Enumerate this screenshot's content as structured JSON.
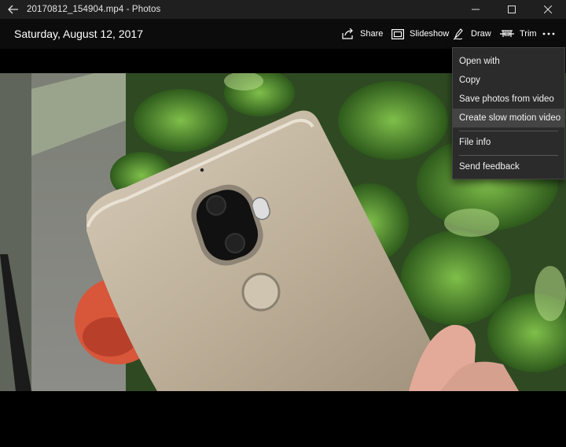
{
  "window": {
    "title": "20170812_154904.mp4 - Photos",
    "back_icon": "back-arrow-icon",
    "controls": [
      "minimize-icon",
      "maximize-icon",
      "close-icon"
    ]
  },
  "commandbar": {
    "date": "Saturday, August 12, 2017",
    "share": {
      "label": "Share",
      "icon": "share-icon"
    },
    "slideshow": {
      "label": "Slideshow",
      "icon": "slideshow-icon"
    },
    "draw": {
      "label": "Draw",
      "icon": "pen-icon"
    },
    "trim": {
      "label": "Trim",
      "icon": "trim-icon"
    },
    "more_icon": "more-ellipsis-icon"
  },
  "menu": {
    "items": [
      {
        "label": "Open with"
      },
      {
        "label": "Copy"
      },
      {
        "label": "Save photos from video"
      },
      {
        "label": "Create slow motion video"
      },
      {
        "label": "File info"
      },
      {
        "label": "Send feedback"
      }
    ],
    "highlighted": "Create slow motion video"
  },
  "colors": {
    "titlebar": "#1f1f1f",
    "commandbar": "#0c0c0c",
    "menu_bg": "#2b2b2b",
    "menu_highlight": "#444444"
  }
}
